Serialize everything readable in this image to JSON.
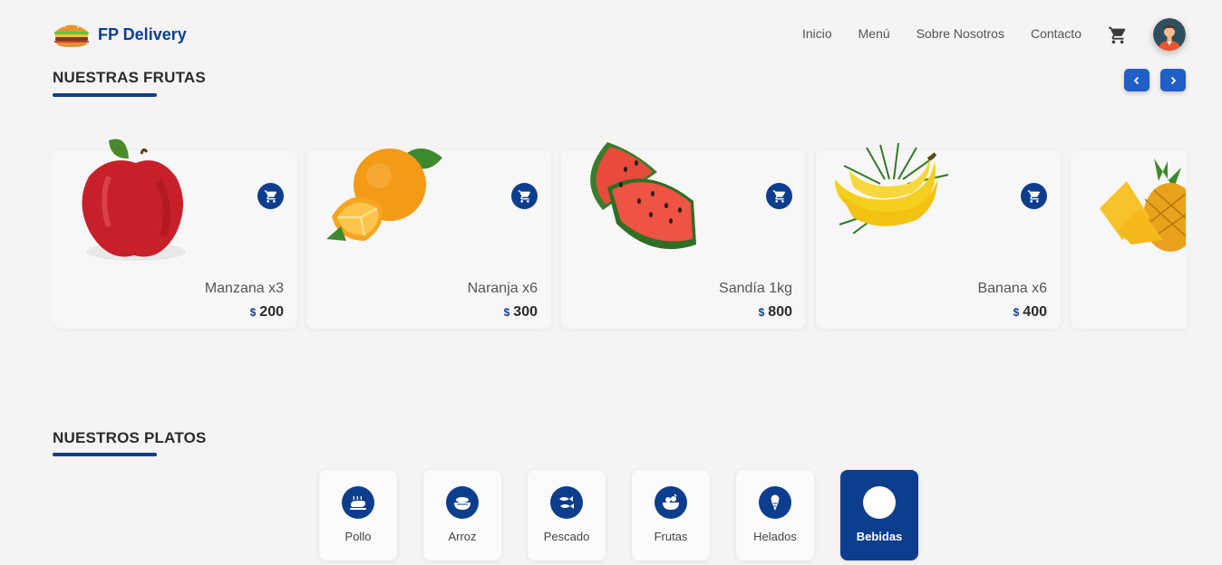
{
  "brand": {
    "name": "FP Delivery",
    "logo_icon": "burger-icon"
  },
  "nav": [
    {
      "label": "Inicio"
    },
    {
      "label": "Menú"
    },
    {
      "label": "Sobre Nosotros"
    },
    {
      "label": "Contacto"
    }
  ],
  "header_icons": {
    "cart": "cart-icon",
    "avatar": "user-avatar"
  },
  "fruits_section": {
    "title": "NUESTRAS FRUTAS",
    "prev_icon": "chevron-left-icon",
    "next_icon": "chevron-right-icon",
    "items": [
      {
        "name": "Manzana x3",
        "currency": "$",
        "price": "200",
        "icon": "apple"
      },
      {
        "name": "Naranja x6",
        "currency": "$",
        "price": "300",
        "icon": "orange"
      },
      {
        "name": "Sandía 1kg",
        "currency": "$",
        "price": "800",
        "icon": "watermelon"
      },
      {
        "name": "Banana x6",
        "currency": "$",
        "price": "400",
        "icon": "banana"
      },
      {
        "name": "",
        "currency": "",
        "price": "",
        "icon": "pineapple"
      }
    ]
  },
  "dishes_section": {
    "title": "NUESTROS PLATOS",
    "categories": [
      {
        "label": "Pollo",
        "icon": "chicken-icon",
        "active": false
      },
      {
        "label": "Arroz",
        "icon": "rice-bowl-icon",
        "active": false
      },
      {
        "label": "Pescado",
        "icon": "fish-icon",
        "active": false
      },
      {
        "label": "Frutas",
        "icon": "fruit-bowl-icon",
        "active": false
      },
      {
        "label": "Helados",
        "icon": "ice-cream-icon",
        "active": false
      },
      {
        "label": "Bebidas",
        "icon": "drink-icon",
        "active": true
      }
    ]
  },
  "colors": {
    "primary": "#0d3e8e",
    "accent": "#1f5fc7",
    "background": "#f5f3f3"
  }
}
